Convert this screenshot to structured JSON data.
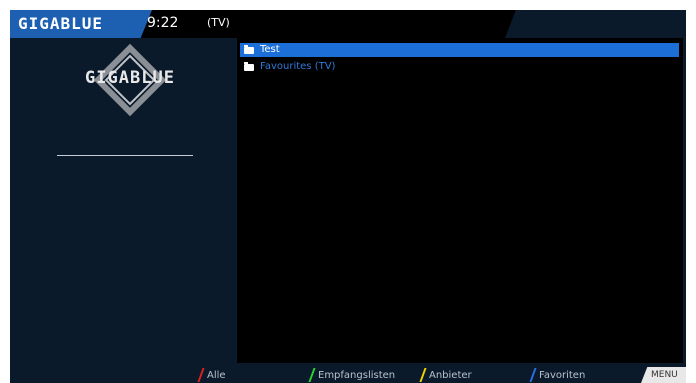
{
  "header": {
    "brand": "GIGABLUE",
    "clock": "9:22",
    "mode": "(TV)"
  },
  "sidebar": {
    "logo_text": "GIGABLUE"
  },
  "list": {
    "items": [
      {
        "label": "Test",
        "selected": true,
        "icon": "folder-icon"
      },
      {
        "label": "Favourites (TV)",
        "selected": false,
        "icon": "folder-icon"
      }
    ]
  },
  "footer": {
    "buttons": [
      {
        "label": "Alle",
        "color": "#e02020"
      },
      {
        "label": "Empfangslisten",
        "color": "#2fd12f"
      },
      {
        "label": "Anbieter",
        "color": "#f2d400"
      },
      {
        "label": "Favoriten",
        "color": "#2f6fe0"
      }
    ],
    "menu_label": "MENU"
  },
  "colors": {
    "accent": "#1d6fd8",
    "background": "#0b1a2b",
    "panel": "#000000"
  }
}
